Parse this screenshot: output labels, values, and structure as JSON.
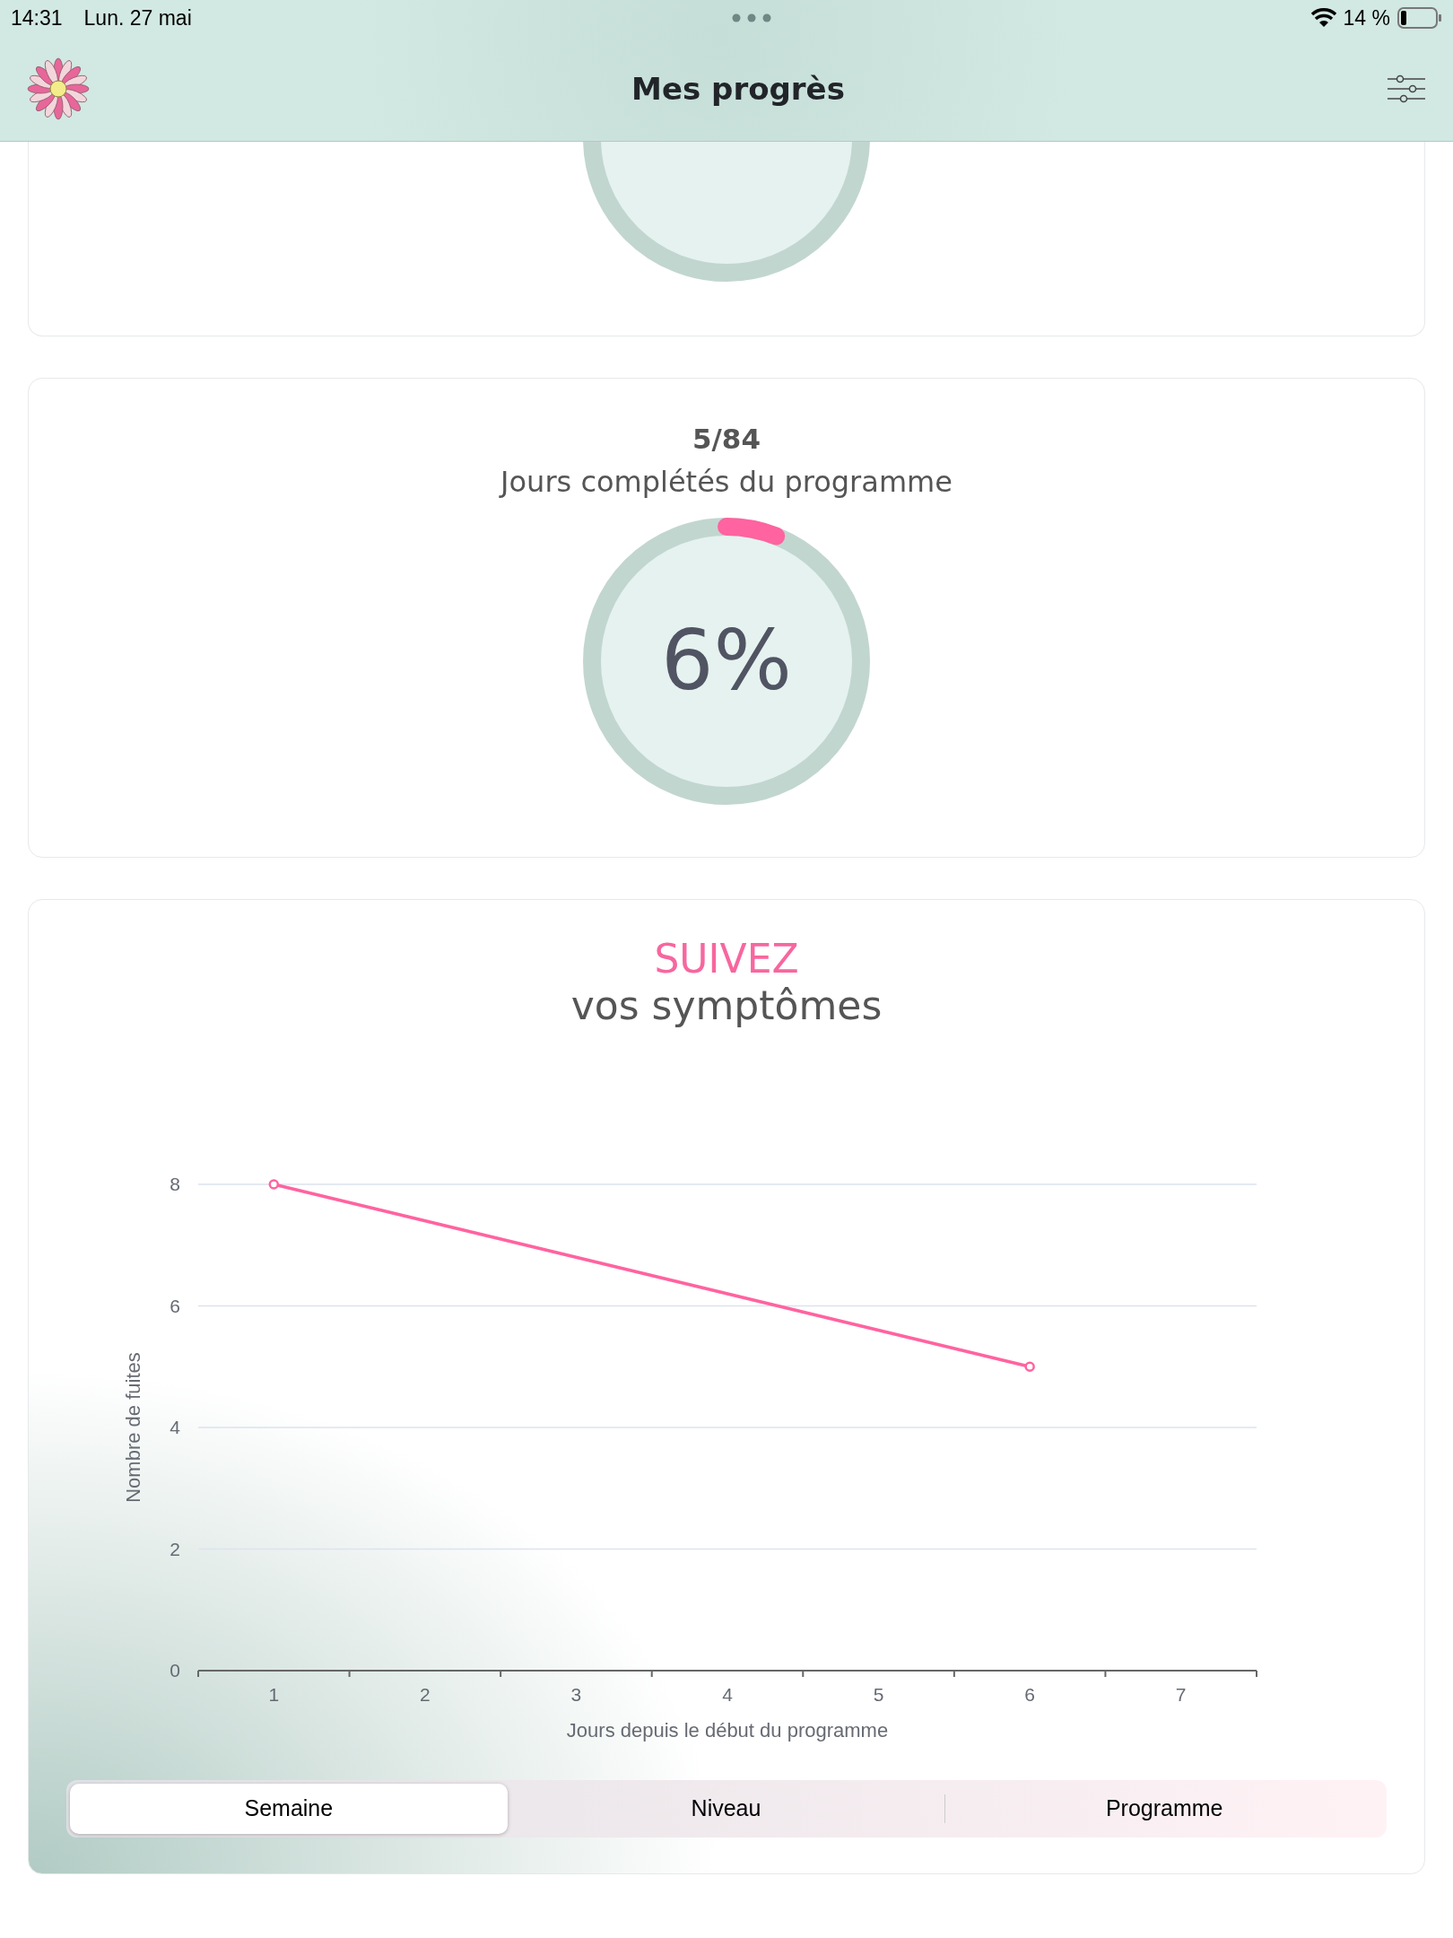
{
  "status_bar": {
    "time": "14:31",
    "date": "Lun. 27 mai",
    "battery": "14 %"
  },
  "header": {
    "title": "Mes progrès"
  },
  "cards": [
    {
      "kind": "ring_only"
    },
    {
      "kind": "ring",
      "count": "5/84",
      "caption": "Jours complétés du programme",
      "percent": "6%",
      "level": 0.06
    },
    {
      "kind": "chart",
      "title": "SUIVEZ",
      "subtitle": "vos symptômes",
      "chart_data": {
        "type": "line",
        "xlabel": "Jours depuis le début du programme",
        "ylabel": "Nombre de fuites",
        "x": [
          1,
          6
        ],
        "grid": true,
        "series": [
          {
            "color": "#ff63a0",
            "marker": "circle",
            "values": [
              8,
              5
            ]
          }
        ],
        "xlim": [
          0.5,
          7.5
        ],
        "ylim": [
          0,
          8
        ],
        "xticks": [
          1,
          2,
          3,
          4,
          5,
          6,
          7
        ],
        "yticks": [
          0,
          2,
          4,
          6,
          8
        ]
      },
      "segments": [
        {
          "label": "Semaine",
          "selected": true
        },
        {
          "label": "Niveau",
          "selected": false
        },
        {
          "label": "Programme",
          "selected": false
        }
      ]
    }
  ]
}
